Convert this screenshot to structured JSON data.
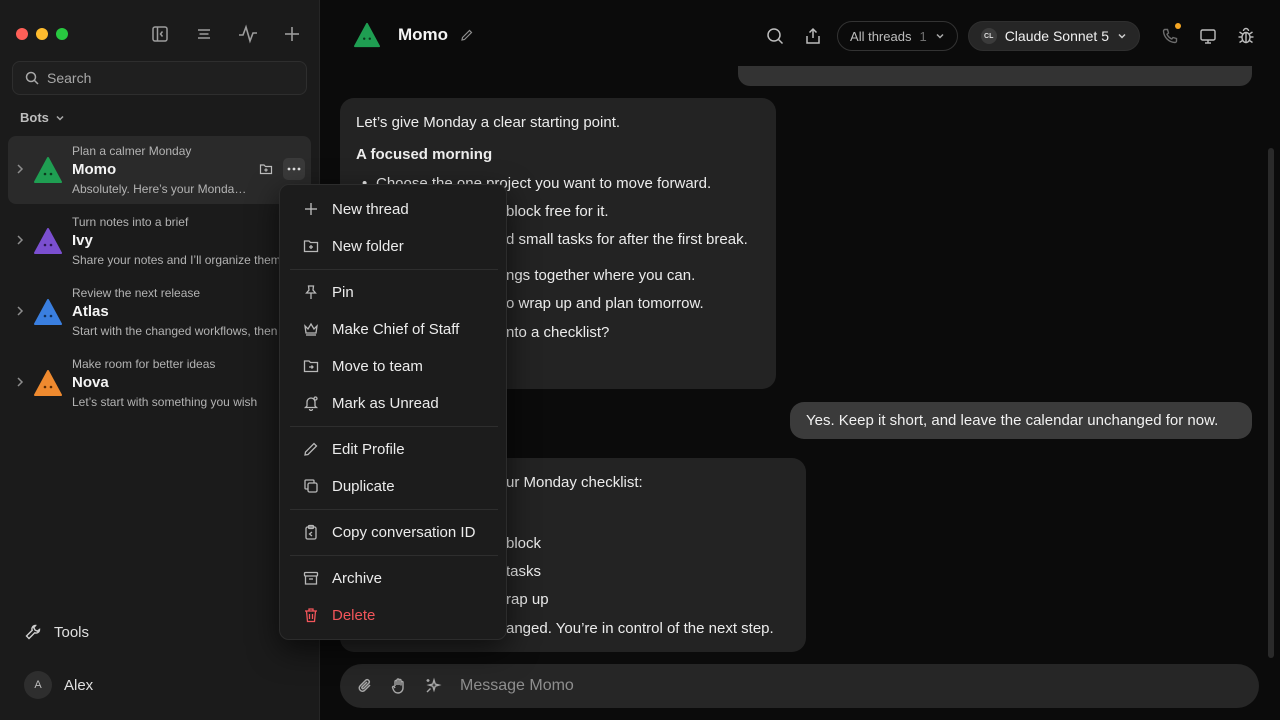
{
  "sidebar": {
    "search_placeholder": "Search",
    "section_label": "Bots",
    "bots": [
      {
        "subtitle": "Plan a calmer Monday",
        "name": "Momo",
        "preview": "Absolutely. Here’s your Monday plan",
        "color": "#1f9e52"
      },
      {
        "subtitle": "Turn notes into a brief",
        "name": "Ivy",
        "preview": "Share your notes and I’ll organize them",
        "color": "#7b4fd0"
      },
      {
        "subtitle": "Review the next release",
        "name": "Atlas",
        "preview": "Start with the changed workflows, then",
        "color": "#3a7fe0"
      },
      {
        "subtitle": "Make room for better ideas",
        "name": "Nova",
        "preview": "Let’s start with something you wish",
        "color": "#ef8a2f"
      }
    ],
    "tools_label": "Tools",
    "user": {
      "initial": "A",
      "name": "Alex"
    }
  },
  "header": {
    "title": "Momo",
    "threads_label": "All threads",
    "threads_count": "1",
    "model_badge": "CL",
    "model_label": "Claude Sonnet 5"
  },
  "messages": {
    "bot1": {
      "intro": "Let’s give Monday a clear starting point.",
      "heading": "A focused morning",
      "items": [
        "Choose the one project you want to move forward.",
        "block free for it.",
        "d small tasks for after the first break."
      ],
      "items2": [
        "ngs together where you can.",
        "o wrap up and plan tomorrow."
      ],
      "outro": "nto a checklist?"
    },
    "user1": "Yes. Keep it short, and leave the calendar unchanged for now.",
    "bot2": {
      "intro": "ur Monday checklist:",
      "items": [
        "block",
        "tasks",
        "rap up"
      ],
      "outro": "anged. You’re in control of the next step."
    }
  },
  "composer": {
    "placeholder": "Message Momo"
  },
  "menu": {
    "items": [
      {
        "label": "New thread",
        "icon": "plus-icon"
      },
      {
        "label": "New folder",
        "icon": "folder-plus-icon"
      },
      {
        "label": "Pin",
        "icon": "pin-icon"
      },
      {
        "label": "Make Chief of Staff",
        "icon": "crown-icon"
      },
      {
        "label": "Move to team",
        "icon": "folder-move-icon"
      },
      {
        "label": "Mark as Unread",
        "icon": "bell-icon"
      },
      {
        "label": "Edit Profile",
        "icon": "pencil-icon"
      },
      {
        "label": "Duplicate",
        "icon": "duplicate-icon"
      },
      {
        "label": "Copy conversation ID",
        "icon": "clipboard-icon"
      },
      {
        "label": "Archive",
        "icon": "archive-icon"
      },
      {
        "label": "Delete",
        "icon": "trash-icon"
      }
    ]
  },
  "colors": {
    "accent_green": "#1f9e52",
    "danger": "#f2555a",
    "notification": "#f5a623"
  }
}
